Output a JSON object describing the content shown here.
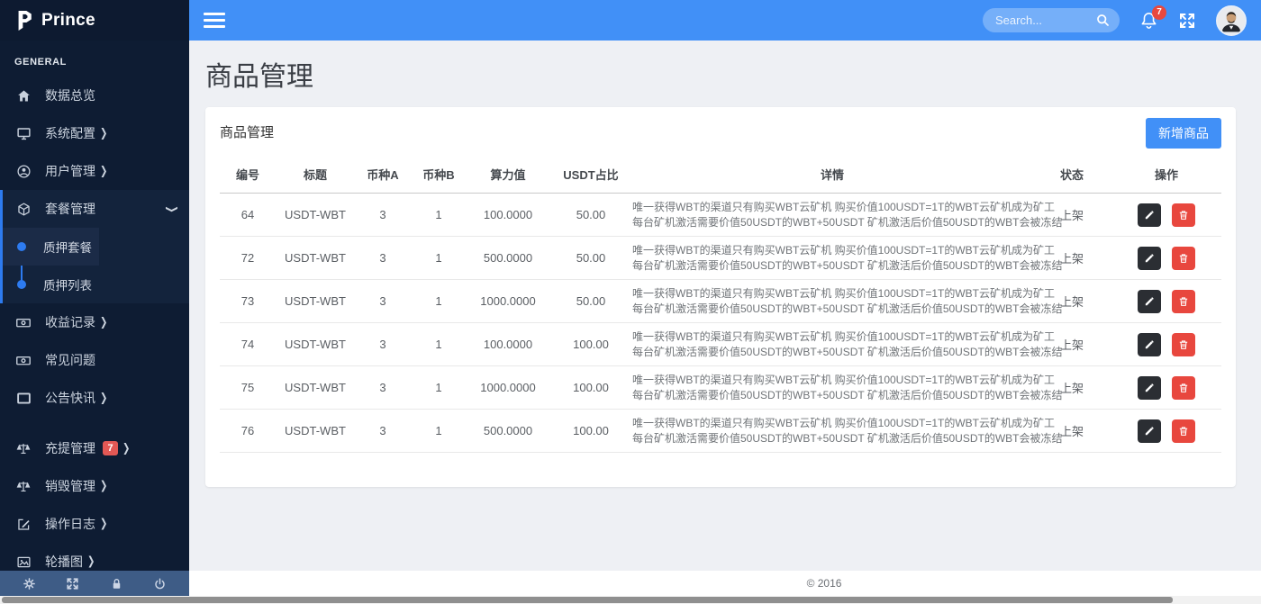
{
  "brand": {
    "name": "Prince"
  },
  "sidebar": {
    "section_label": "GENERAL",
    "items": [
      {
        "label": "数据总览",
        "icon": "home-icon",
        "arrow": false
      },
      {
        "label": "系统配置",
        "icon": "monitor-icon",
        "arrow": true
      },
      {
        "label": "用户管理",
        "icon": "user-icon",
        "arrow": true
      },
      {
        "label": "套餐管理",
        "icon": "cube-icon",
        "expanded": true,
        "children": [
          {
            "label": "质押套餐",
            "active": true
          },
          {
            "label": "质押列表",
            "active": false
          }
        ]
      },
      {
        "label": "收益记录",
        "icon": "money-icon",
        "arrow": true
      },
      {
        "label": "常见问题",
        "icon": "money-icon",
        "arrow": false
      },
      {
        "label": "公告快讯",
        "icon": "window-icon",
        "arrow": true
      },
      {
        "label": "充提管理",
        "icon": "scale-icon",
        "arrow": true,
        "badge": "7",
        "gap_before": true
      },
      {
        "label": "销毁管理",
        "icon": "scale-icon",
        "arrow": true
      },
      {
        "label": "操作日志",
        "icon": "edit-icon",
        "arrow": true
      },
      {
        "label": "轮播图",
        "icon": "image-icon",
        "arrow": true
      }
    ],
    "footer_icons": [
      "gear-icon",
      "expand-icon",
      "lock-icon",
      "power-icon"
    ]
  },
  "topbar": {
    "search_placeholder": "Search...",
    "notification_count": "7"
  },
  "page": {
    "title": "商品管理"
  },
  "card": {
    "title": "商品管理",
    "add_button_label": "新增商品"
  },
  "table": {
    "headers": [
      "编号",
      "标题",
      "币种A",
      "币种B",
      "算力值",
      "USDT占比",
      "详情",
      "状态",
      "操作"
    ],
    "detail_line1": "唯一获得WBT的渠道只有购买WBT云矿机 购买价值100USDT=1T的WBT云矿机成为矿工",
    "detail_line2": "每台矿机激活需要价值50USDT的WBT+50USDT 矿机激活后价值50USDT的WBT会被冻结",
    "rows": [
      {
        "id": "64",
        "title": "USDT-WBT",
        "coin_a": "3",
        "coin_b": "1",
        "power": "100.0000",
        "usdt_ratio": "50.00",
        "status": "上架"
      },
      {
        "id": "72",
        "title": "USDT-WBT",
        "coin_a": "3",
        "coin_b": "1",
        "power": "500.0000",
        "usdt_ratio": "50.00",
        "status": "上架"
      },
      {
        "id": "73",
        "title": "USDT-WBT",
        "coin_a": "3",
        "coin_b": "1",
        "power": "1000.0000",
        "usdt_ratio": "50.00",
        "status": "上架"
      },
      {
        "id": "74",
        "title": "USDT-WBT",
        "coin_a": "3",
        "coin_b": "1",
        "power": "100.0000",
        "usdt_ratio": "100.00",
        "status": "上架"
      },
      {
        "id": "75",
        "title": "USDT-WBT",
        "coin_a": "3",
        "coin_b": "1",
        "power": "1000.0000",
        "usdt_ratio": "100.00",
        "status": "上架"
      },
      {
        "id": "76",
        "title": "USDT-WBT",
        "coin_a": "3",
        "coin_b": "1",
        "power": "500.0000",
        "usdt_ratio": "100.00",
        "status": "上架"
      }
    ]
  },
  "footer": {
    "copyright": "© 2016"
  },
  "colors": {
    "topbar_blue": "#4190f7",
    "sidebar_dark": "#0e1c33",
    "accent_blue": "#2d7bf0",
    "badge_red": "#e25855",
    "delete_red": "#e8473e",
    "edit_dark": "#2b2e33"
  }
}
